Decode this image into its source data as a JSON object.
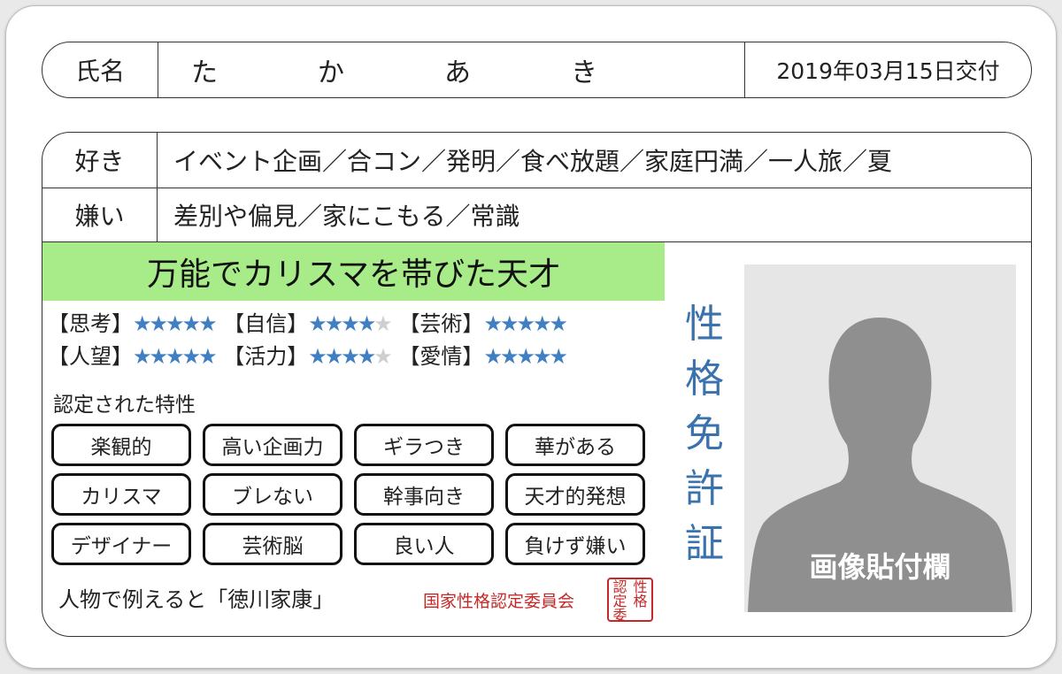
{
  "name": {
    "label": "氏名",
    "chars": [
      "た",
      "か",
      "あ",
      "き"
    ],
    "issued": "2019年03月15日交付"
  },
  "likes": {
    "label": "好き",
    "value": "イベント企画／合コン／発明／食べ放題／家庭円満／一人旅／夏"
  },
  "dislikes": {
    "label": "嫌い",
    "value": "差別や偏見／家にこもる／常識"
  },
  "headline": "万能でカリスマを帯びた天才",
  "stats": [
    {
      "name": "【思考】",
      "stars": 5
    },
    {
      "name": "【自信】",
      "stars": 4
    },
    {
      "name": "【芸術】",
      "stars": 5
    },
    {
      "name": "【人望】",
      "stars": 5
    },
    {
      "name": "【活力】",
      "stars": 4
    },
    {
      "name": "【愛情】",
      "stars": 5
    }
  ],
  "stars_max": 5,
  "star_colors": {
    "on": "#3f7fc2",
    "off": "#cfcfcf"
  },
  "traits_label": "認定された特性",
  "traits": [
    "楽観的",
    "高い企画力",
    "ギラつき",
    "華がある",
    "カリスマ",
    "ブレない",
    "幹事向き",
    "天才的発想",
    "デザイナー",
    "芸術脳",
    "良い人",
    "負けず嫌い"
  ],
  "person": "人物で例えると「徳川家康」",
  "committee": "国家性格認定委員会",
  "seal": [
    "認",
    "性",
    "定",
    "格",
    "委",
    ""
  ],
  "license_title": [
    "性",
    "格",
    "免",
    "許",
    "証"
  ],
  "photo_label": "画像貼付欄",
  "colors": {
    "headline_bg": "#a8ec8a",
    "title_blue": "#3a72ad",
    "seal_red": "#c62828"
  }
}
